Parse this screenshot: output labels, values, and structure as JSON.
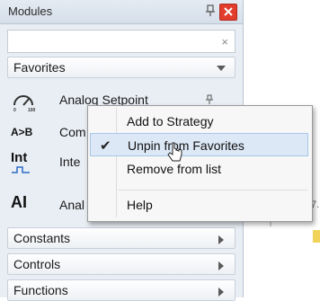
{
  "panel": {
    "title": "Modules",
    "search": {
      "value": "",
      "clear_glyph": "×"
    },
    "favorites_label": "Favorites",
    "items": [
      {
        "label": "Analog Setpoint",
        "icon": "gauge-icon"
      },
      {
        "label": "Com",
        "icon_text": "A>B",
        "icon": "compare-icon"
      },
      {
        "label": "Inte",
        "icon_text": "Int",
        "icon": "integer-icon"
      },
      {
        "label": "Anal",
        "icon_text": "AI",
        "icon": "analog-input-icon"
      }
    ],
    "sections": [
      {
        "label": "Constants"
      },
      {
        "label": "Controls"
      },
      {
        "label": "Functions"
      }
    ]
  },
  "context_menu": {
    "items": [
      {
        "label": "Add to Strategy",
        "checked": false
      },
      {
        "label": "Unpin from Favorites",
        "checked": true
      },
      {
        "label": "Remove from list",
        "checked": false
      },
      {
        "label": "Help",
        "checked": false
      }
    ]
  },
  "colors": {
    "close": "#e23c2c",
    "highlight": "#dde8f6",
    "panel_bg": "#e9eef4"
  }
}
